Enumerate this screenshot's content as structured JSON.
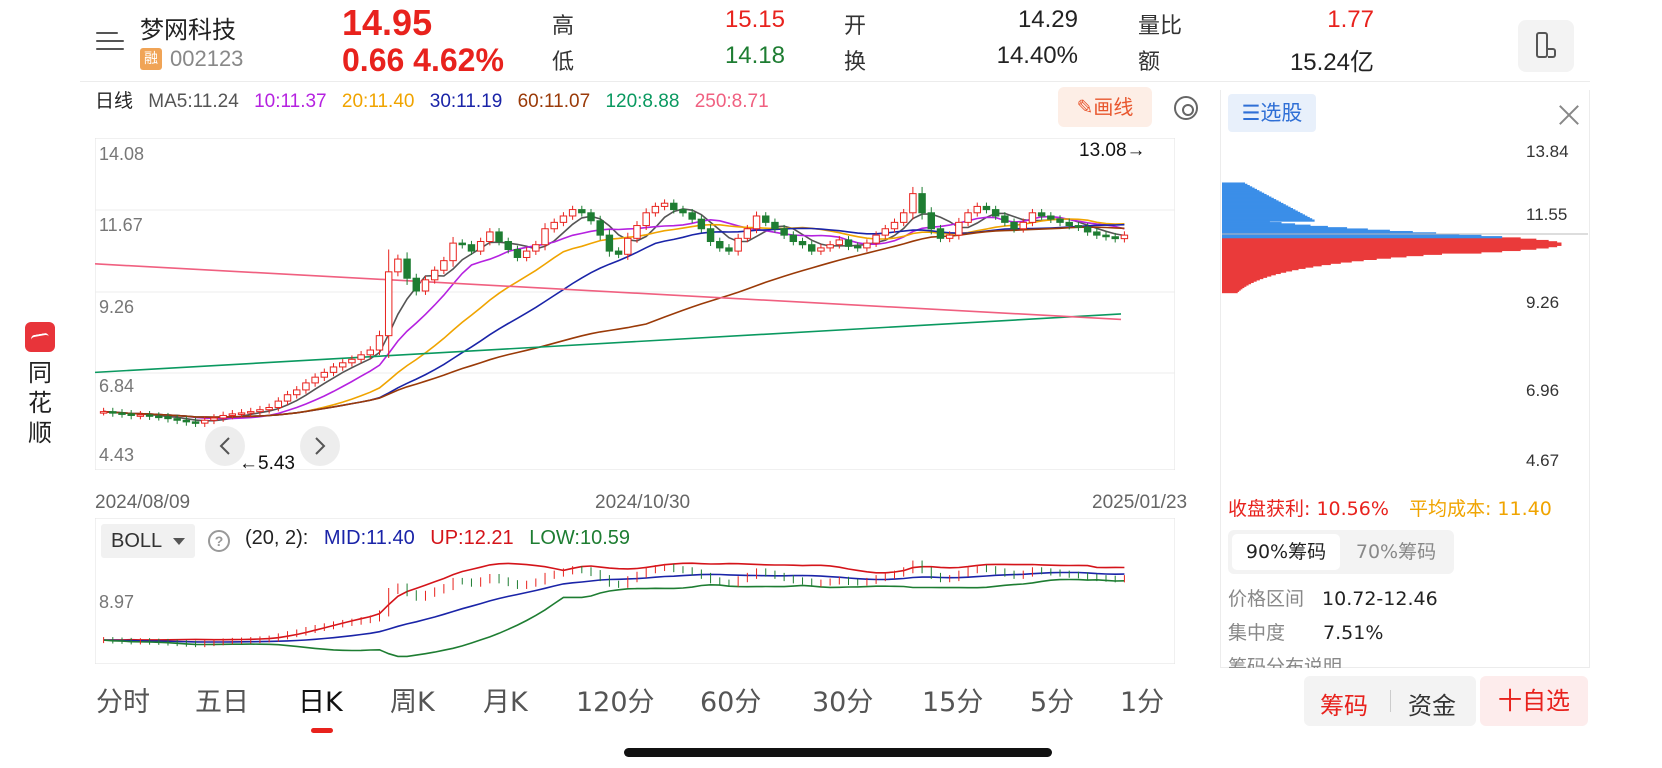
{
  "brand": {
    "name": "同花顺",
    "chars": [
      "同",
      "花",
      "顺"
    ]
  },
  "header": {
    "stock_name": "梦网科技",
    "rong_badge": "融",
    "stock_code": "002123",
    "price": "14.95",
    "change": "0.66  4.62%",
    "stats": {
      "high_label": "高",
      "high": "15.15",
      "low_label": "低",
      "low": "14.18",
      "open_label": "开",
      "open": "14.29",
      "turnover_label": "换",
      "turnover": "14.40%",
      "vol_ratio_label": "量比",
      "vol_ratio": "1.77",
      "amount_label": "额",
      "amount": "15.24亿"
    }
  },
  "ma_row": {
    "period": "日线",
    "ma5": "MA5:11.24",
    "ma10": "10:11.37",
    "ma20": "20:11.40",
    "ma30": "30:11.19",
    "ma60": "60:11.07",
    "ma120": "120:8.88",
    "ma250": "250:8.71"
  },
  "draw_button": "画线",
  "main_chart": {
    "y_labels": [
      "14.08",
      "11.67",
      "9.26",
      "6.84",
      "4.43"
    ],
    "high_marker": "13.08→",
    "low_marker": "←5.43",
    "dates": [
      "2024/08/09",
      "2024/10/30",
      "2025/01/23"
    ]
  },
  "chip_panel": {
    "select_label": "选股",
    "y_labels": [
      "13.84",
      "11.55",
      "9.26",
      "6.96",
      "4.67"
    ],
    "profit_label": "收盘获利:",
    "profit_value": "10.56%",
    "avg_cost_label": "平均成本:",
    "avg_cost_value": "11.40",
    "tab_90": "90%筹码",
    "tab_70": "70%筹码",
    "price_range_label": "价格区间",
    "price_range_value": "10.72-12.46",
    "concentration_label": "集中度",
    "concentration_value": "7.51%",
    "dist_note": "筹码分布说明"
  },
  "boll": {
    "indicator": "BOLL",
    "params": "(20, 2):",
    "mid": "MID:11.40",
    "up": "UP:12.21",
    "low": "LOW:10.59",
    "y_label": "8.97"
  },
  "period_tabs": [
    "分时",
    "五日",
    "日K",
    "周K",
    "月K",
    "120分",
    "60分",
    "30分",
    "15分",
    "5分",
    "1分"
  ],
  "active_tab": "日K",
  "bottom_buttons": {
    "chips": "筹码",
    "funds": "资金",
    "add_watch": "十自选"
  },
  "colors": {
    "up": "#e8221d",
    "down": "#1e7d32",
    "ma5": "#555555",
    "ma10": "#b522e0",
    "ma20": "#f0a400",
    "ma30": "#1a24a8",
    "ma60": "#9a3a08",
    "ma120": "#0a9960",
    "ma250": "#f06080",
    "chip_blue": "#3b8ee8",
    "chip_red": "#ea3a3a"
  },
  "chart_data": {
    "type": "candlestick",
    "note": "",
    "y_range": [
      4.43,
      14.08
    ],
    "closes": [
      5.82,
      5.78,
      5.75,
      5.7,
      5.72,
      5.68,
      5.66,
      5.6,
      5.55,
      5.5,
      5.46,
      5.55,
      5.62,
      5.7,
      5.75,
      5.78,
      5.82,
      5.88,
      5.95,
      6.15,
      6.35,
      6.5,
      6.72,
      6.9,
      7.05,
      7.22,
      7.35,
      7.46,
      7.6,
      7.75,
      8.2,
      10.2,
      10.6,
      10.0,
      9.6,
      9.95,
      10.25,
      10.55,
      11.1,
      11.05,
      10.85,
      11.15,
      11.45,
      11.15,
      10.9,
      10.65,
      10.85,
      11.05,
      11.55,
      11.75,
      11.95,
      12.15,
      12.05,
      11.8,
      11.35,
      10.85,
      10.75,
      11.25,
      11.65,
      12.05,
      12.25,
      12.35,
      12.15,
      12.05,
      11.85,
      11.55,
      11.15,
      10.95,
      10.85,
      11.25,
      11.55,
      11.95,
      11.75,
      11.55,
      11.35,
      11.15,
      11.05,
      10.85,
      10.95,
      11.05,
      11.2,
      11.0,
      10.95,
      11.1,
      11.35,
      11.55,
      11.75,
      12.05,
      12.65,
      12.05,
      11.55,
      11.25,
      11.35,
      11.75,
      12.05,
      12.25,
      12.15,
      11.95,
      11.75,
      11.55,
      11.75,
      12.05,
      11.95,
      11.85,
      11.75,
      11.65,
      11.6,
      11.45,
      11.35,
      11.3,
      11.24,
      11.35
    ]
  }
}
